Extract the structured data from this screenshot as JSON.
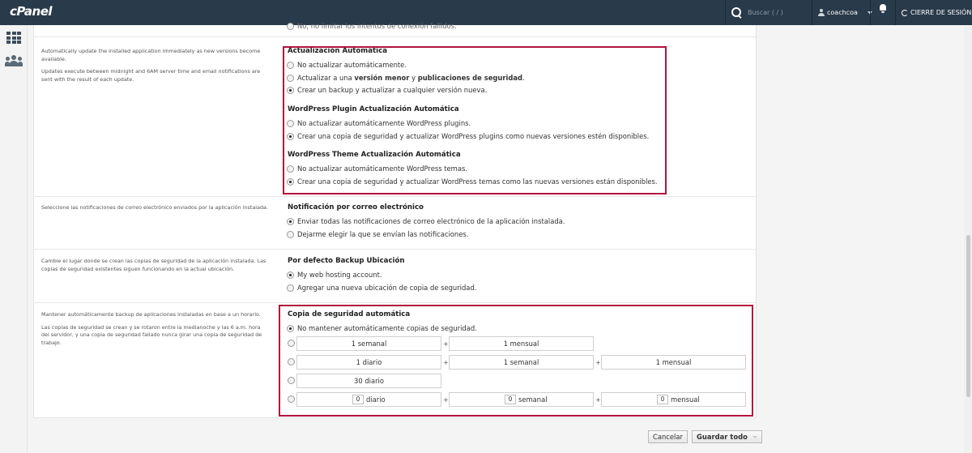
{
  "topbar": {
    "logo": "cPanel",
    "search_placeholder": "Buscar ( / )",
    "username": "coachcoa",
    "logout_label": "CIERRE DE SESIÓN"
  },
  "sections": {
    "top_cut_text": "No, no limitar los intentos de conexión fallidos.",
    "auto_update": {
      "desc1": "Automatically update the installed application immediately as new versions become available.",
      "desc2": "Updates execute between midnight and 6AM server time and email notifications are sent with the result of each update.",
      "title": "Actualización Automática",
      "opt1": "No actualizar automáticamente.",
      "opt2_pre": "Actualizar a una ",
      "opt2_b1": "versión menor",
      "opt2_mid": " y ",
      "opt2_b2": "publicaciones de seguridad",
      "opt2_post": ".",
      "opt3": "Crear un backup y actualizar a cualquier versión nueva.",
      "selected": 3
    },
    "plugin_update": {
      "title": "WordPress Plugin Actualización Automática",
      "opt1": "No actualizar automáticamente WordPress plugins.",
      "opt2": "Crear una copia de seguridad y actualizar WordPress plugins como nuevas versiones estén disponibles.",
      "selected": 2
    },
    "theme_update": {
      "title": "WordPress Theme Actualización Automática",
      "opt1": "No actualizar automáticamente WordPress temas.",
      "opt2": "Crear una copia de seguridad y actualizar WordPress temas como las nuevas versiones están disponibles.",
      "selected": 2
    },
    "email": {
      "desc": "Seleccione las notificaciones de correo electrónico enviados por la aplicación instalada.",
      "title": "Notificación por correo electrónico",
      "opt1": "Enviar todas las notificaciones de correo electrónico de la aplicación instalada.",
      "opt2": "Dejarme elegir la que se envían las notificaciones.",
      "selected": 1
    },
    "backup_location": {
      "desc": "Cambie el lugar donde se crean las copias de seguridad de la aplicación instalada. Las copias de seguridad existentes siguen funcionando en la actual ubicación.",
      "title": "Por defecto Backup Ubicación",
      "opt1": "My web hosting account.",
      "opt2": "Agregar una nueva ubicación de copia de seguridad.",
      "selected": 1
    },
    "auto_backup": {
      "desc1": "Mantener automáticamente backup de aplicaciones instaladas en base a un horario.",
      "desc2": "Las copias de seguridad se crean y se rotaron entre la medianoche y las 6 a.m. hora del servidor, y una copia de seguridad fallado nunca girar una copia de seguridad de trabajo.",
      "title": "Copia de seguridad automática",
      "opt1": "No mantener automáticamente copias de seguridad.",
      "plus": "+",
      "row1": [
        "1 semanal",
        "1 mensual"
      ],
      "row2": [
        "1 diario",
        "1 semanal",
        "1 mensual"
      ],
      "row3": [
        "30 diario"
      ],
      "row4": {
        "daily_value": "0",
        "daily_label": "diario",
        "weekly_value": "0",
        "weekly_label": "semanal",
        "monthly_value": "0",
        "monthly_label": "mensual"
      },
      "selected": 1
    }
  },
  "actions": {
    "cancel": "Cancelar",
    "save_all": "Guardar todo"
  },
  "colors": {
    "topbar": "#293a4a",
    "highlight": "#b0123e"
  }
}
